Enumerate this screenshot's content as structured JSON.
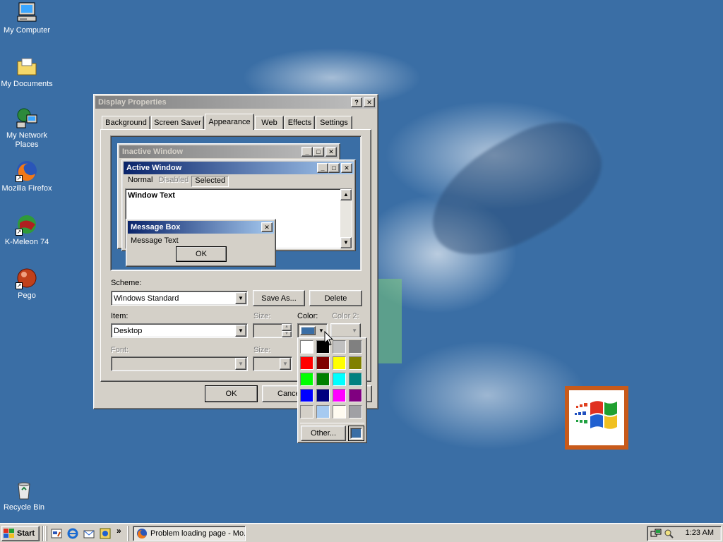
{
  "desktop": {
    "icons": [
      {
        "label": "My Computer"
      },
      {
        "label": "My Documents"
      },
      {
        "label": "My Network Places"
      },
      {
        "label": "Mozilla Firefox"
      },
      {
        "label": "K-Meleon 74"
      },
      {
        "label": "Pego"
      },
      {
        "label": "Recycle Bin"
      }
    ]
  },
  "dialog": {
    "title": "Display Properties",
    "help_glyph": "?",
    "close_glyph": "✕",
    "tabs": [
      "Background",
      "Screen Saver",
      "Appearance",
      "Web",
      "Effects",
      "Settings"
    ],
    "selected_tab": "Appearance",
    "preview": {
      "inactive_title": "Inactive Window",
      "active_title": "Active Window",
      "menu": [
        "Normal",
        "Disabled",
        "Selected"
      ],
      "window_text": "Window Text",
      "msgbox_title": "Message Box",
      "msgbox_text": "Message Text",
      "msgbox_ok": "OK"
    },
    "scheme_label": "Scheme:",
    "scheme_value": "Windows Standard",
    "save_as_label": "Save As...",
    "delete_label": "Delete",
    "item_label": "Item:",
    "item_value": "Desktop",
    "size_label": "Size:",
    "color_label": "Color:",
    "color2_label": "Color 2:",
    "font_label": "Font:",
    "font_size_label": "Size:",
    "ok_label": "OK",
    "cancel_label": "Cancel",
    "selected_color": "#3a6ea5"
  },
  "color_popup": {
    "colors": [
      "#ffffff",
      "#000000",
      "#c0c0c0",
      "#808080",
      "#ff0000",
      "#800000",
      "#ffff00",
      "#808000",
      "#00ff00",
      "#008000",
      "#00ffff",
      "#008080",
      "#0000ff",
      "#000080",
      "#ff00ff",
      "#800080",
      "#d4d0c8",
      "#a6caf0",
      "#fffbf0",
      "#a0a0a4"
    ],
    "other_label": "Other...",
    "current_color": "#3a6ea5"
  },
  "taskbar": {
    "start_label": "Start",
    "quicklaunch_more": "»",
    "task_label": "Problem loading page - Mo...",
    "clock": "1:23 AM"
  }
}
